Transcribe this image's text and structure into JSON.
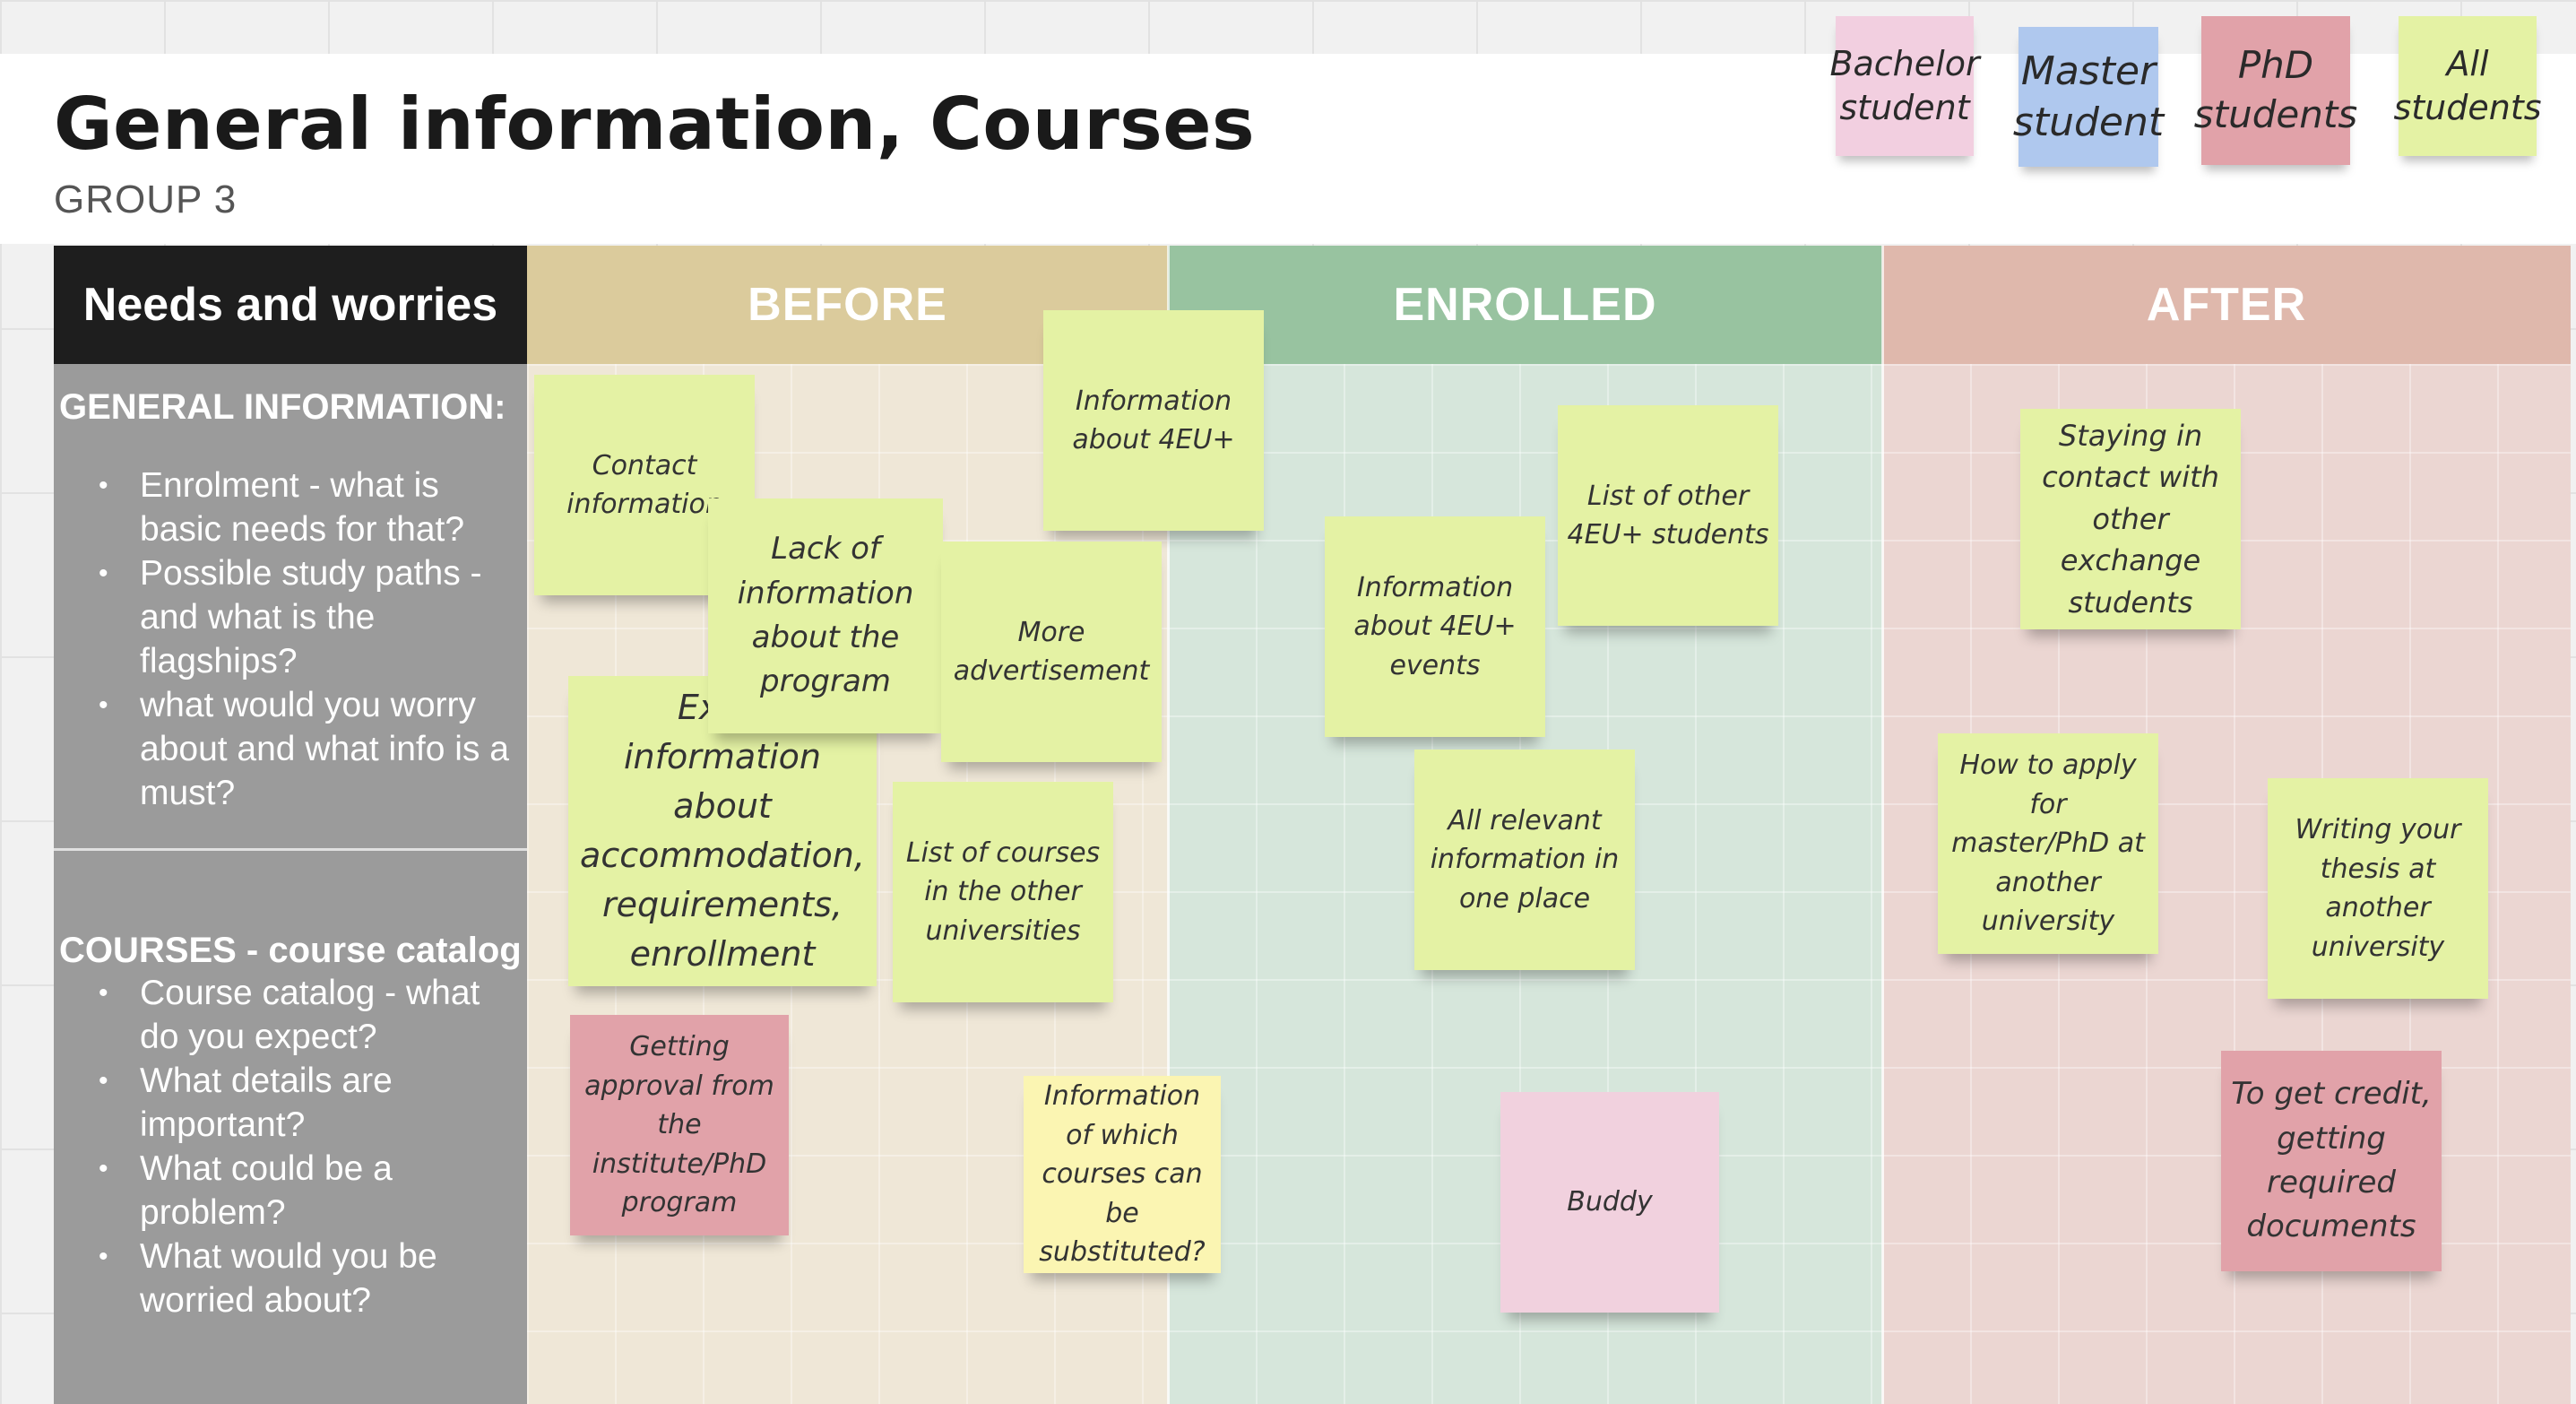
{
  "board": {
    "title": "General information, Courses",
    "subtitle": "GROUP 3"
  },
  "legend": [
    {
      "label": "Bachelor student",
      "color": "#f2cfe0"
    },
    {
      "label": "Master student",
      "color": "#afc8ee"
    },
    {
      "label": "PhD students",
      "color": "#e1a2a9"
    },
    {
      "label": "All students",
      "color": "#e4f2a4"
    }
  ],
  "columns": {
    "needs": {
      "label": "Needs and worries",
      "color": "#1e1e1e"
    },
    "before": {
      "label": "BEFORE",
      "header_color": "#dbcb9c",
      "body_color": "#efe7d7"
    },
    "enrolled": {
      "label": "ENROLLED",
      "header_color": "#98c3a0",
      "body_color": "#d6e6db"
    },
    "after": {
      "label": "AFTER",
      "header_color": "#dfb8ac",
      "body_color": "#ebd6d2"
    }
  },
  "sections": [
    {
      "heading": "GENERAL INFORMATION:",
      "items": [
        "Enrolment - what is basic needs for that?",
        "Possible study paths - and what is the flagships?",
        "what would you worry about and what info is a must?"
      ]
    },
    {
      "heading": "COURSES - course catalog",
      "items": [
        "Course catalog - what do you expect?",
        "What details are important?",
        "What could be a problem?",
        "What would you be worried about?"
      ]
    }
  ],
  "notes": {
    "contact_info": "Contact information",
    "info_4eu": "Information about 4EU+",
    "lack_of_info": "Lack of information about the program",
    "more_advertisement": "More advertisement",
    "extra_info": "Extra information about accommodation, requirements, enrollment",
    "list_of_courses": "List of courses in the other universities",
    "getting_approval": "Getting approval from the institute/PhD program",
    "which_courses": "Information of which courses can be substituted?",
    "list_other_students": "List of other 4EU+ students",
    "info_events": "Information about 4EU+ events",
    "all_relevant": "All relevant information in one place",
    "buddy": "Buddy",
    "staying_in_contact": "Staying in contact with other exchange students",
    "how_to_apply": "How to apply for master/PhD at another university",
    "writing_thesis": "Writing your thesis at another university",
    "to_get_credit": "To get credit, getting required documents"
  }
}
